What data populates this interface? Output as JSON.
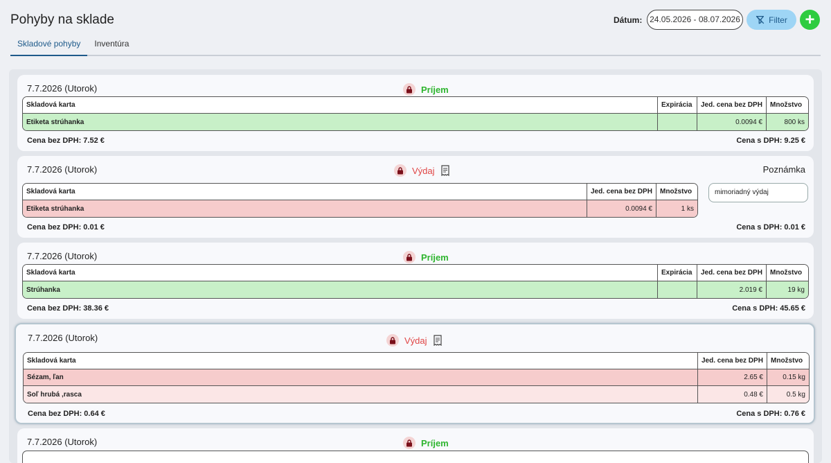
{
  "header": {
    "title": "Pohyby na sklade",
    "tabs": [
      "Skladové pohyby",
      "Inventúra"
    ],
    "date_label": "Dátum:",
    "date_range": "24.05.2026 - 08.07.2026",
    "filter_label": "Filter",
    "add_label": "+"
  },
  "columns": {
    "card": "Skladová karta",
    "expiry": "Expirácia",
    "unit_price": "Jed. cena bez DPH",
    "quantity": "Množstvo"
  },
  "movements": [
    {
      "date": "7.7.2026 (Utorok)",
      "type": "Príjem",
      "rows": [
        {
          "name": "Etiketa strúhanka",
          "expiry": "",
          "price": "0.0094 €",
          "qty": "800 ks"
        }
      ],
      "total_net": "Cena bez DPH: 7.52 €",
      "total_gross": "Cena s DPH: 9.25 €"
    },
    {
      "date": "7.7.2026 (Utorok)",
      "type": "Výdaj",
      "note_title": "Poznámka",
      "note": "mimoriadný výdaj",
      "rows": [
        {
          "name": "Etiketa strúhanka",
          "price": "0.0094 €",
          "qty": "1 ks"
        }
      ],
      "total_net": "Cena bez DPH: 0.01 €",
      "total_gross": "Cena s DPH: 0.01 €"
    },
    {
      "date": "7.7.2026 (Utorok)",
      "type": "Príjem",
      "rows": [
        {
          "name": "Strúhanka",
          "expiry": "",
          "price": "2.019 €",
          "qty": "19 kg"
        }
      ],
      "total_net": "Cena bez DPH: 38.36 €",
      "total_gross": "Cena s DPH: 45.65 €"
    },
    {
      "date": "7.7.2026 (Utorok)",
      "type": "Výdaj",
      "rows": [
        {
          "name": "Sézam, ľan",
          "price": "2.65 €",
          "qty": "0.15 kg"
        },
        {
          "name": "Soľ hrubá ,rasca",
          "price": "0.48 €",
          "qty": "0.5 kg"
        }
      ],
      "total_net": "Cena bez DPH: 0.64 €",
      "total_gross": "Cena s DPH: 0.76 €"
    },
    {
      "date": "7.7.2026 (Utorok)",
      "type": "Príjem"
    }
  ],
  "colors": {
    "income": "#2fb52f",
    "expense": "#e04545",
    "income_row": "#c8f0c8",
    "expense_row": "#f6cccc",
    "accent": "#1e5a8a",
    "add_button": "#2ecc40"
  },
  "icons": [
    "lock-icon",
    "receipt-icon",
    "filter-off-icon",
    "plus-icon"
  ]
}
